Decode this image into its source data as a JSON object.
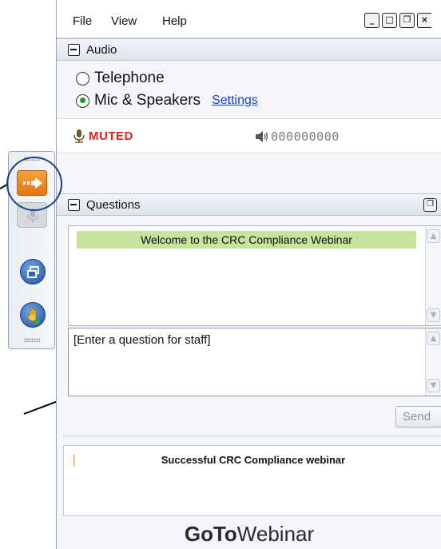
{
  "menu": {
    "file": "File",
    "view": "View",
    "help": "Help"
  },
  "window_buttons": [
    "minimize",
    "maximize",
    "restore",
    "close"
  ],
  "audio": {
    "section_title": "Audio",
    "options": [
      {
        "label": "Telephone",
        "selected": false
      },
      {
        "label": "Mic & Speakers",
        "selected": true
      }
    ],
    "settings_link": "Settings",
    "status": "MUTED",
    "level_meter": "000000000"
  },
  "questions": {
    "section_title": "Questions",
    "messages": [
      "Welcome to the CRC Compliance Webinar"
    ],
    "input_placeholder": "[Enter a question for staff]",
    "send_label": "Send"
  },
  "info": {
    "text": "Successful CRC Compliance webinar"
  },
  "brand": {
    "bold": "GoTo",
    "regular": "Webinar"
  },
  "colors": {
    "muted": "#e4201c",
    "link": "#1b3fd1",
    "welcome_bg": "#c6e49d",
    "toolbar_arrow": "#f08d24",
    "round_button": "#2a63b8"
  },
  "icons": {
    "toolbar": [
      "show-panel-arrow-icon",
      "microphone-icon",
      "restore-window-icon",
      "raise-hand-icon"
    ],
    "speaker": "speaker-icon",
    "mic": "microphone-icon"
  }
}
